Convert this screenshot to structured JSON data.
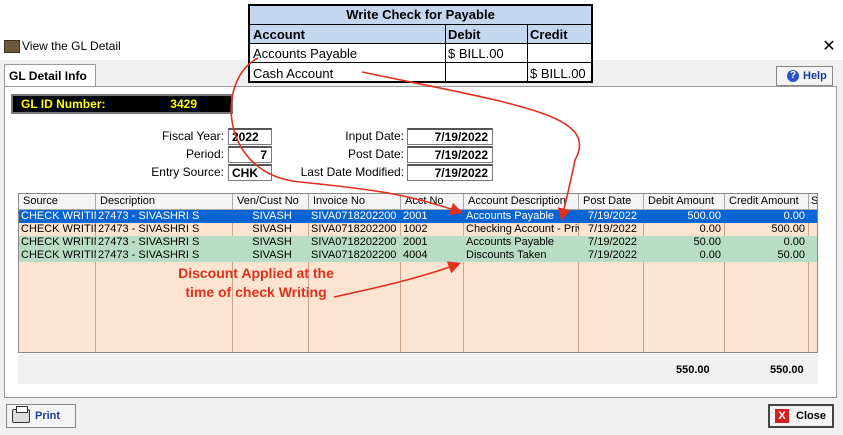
{
  "window": {
    "title": "View the GL Detail",
    "close_glyph": "✕"
  },
  "tabs": [
    {
      "label": "GL Detail Info"
    }
  ],
  "help_label": "Help",
  "gl_id": {
    "label": "GL ID Number:",
    "value": "3429"
  },
  "form": {
    "fiscal_year_label": "Fiscal Year:",
    "fiscal_year": "2022",
    "period_label": "Period:",
    "period": "7",
    "entry_source_label": "Entry Source:",
    "entry_source": "CHK",
    "input_date_label": "Input Date:",
    "input_date": "7/19/2022",
    "post_date_label": "Post Date:",
    "post_date": "7/19/2022",
    "last_modified_label": "Last Date Modified:",
    "last_modified": "7/19/2022"
  },
  "grid": {
    "columns": [
      "Source",
      "Description",
      "Ven/Cust No",
      "Invoice No",
      "Acct No",
      "Account Description",
      "Post Date",
      "Debit Amount",
      "Credit Amount",
      "Se"
    ],
    "rows": [
      {
        "source": "CHECK WRITIN",
        "description": "27473 - SIVASHRI S",
        "ven": "SIVASH",
        "invoice": "SIVA0718202200",
        "acct": "2001",
        "acct_desc": "Accounts Payable",
        "post_date": "7/19/2022",
        "debit": "500.00",
        "credit": "0.00",
        "style": "selected"
      },
      {
        "source": "CHECK WRITIN",
        "description": "27473 - SIVASHRI S",
        "ven": "SIVASH",
        "invoice": "SIVA0718202200",
        "acct": "1002",
        "acct_desc": "Checking Account - Priv",
        "post_date": "7/19/2022",
        "debit": "0.00",
        "credit": "500.00",
        "style": "normal"
      },
      {
        "source": "CHECK WRITIN",
        "description": "27473 - SIVASHRI S",
        "ven": "SIVASH",
        "invoice": "SIVA0718202200",
        "acct": "2001",
        "acct_desc": "Accounts Payable",
        "post_date": "7/19/2022",
        "debit": "50.00",
        "credit": "0.00",
        "style": "highlight"
      },
      {
        "source": "CHECK WRITIN",
        "description": "27473 - SIVASHRI S",
        "ven": "SIVASH",
        "invoice": "SIVA0718202200",
        "acct": "4004",
        "acct_desc": "Discounts Taken",
        "post_date": "7/19/2022",
        "debit": "0.00",
        "credit": "50.00",
        "style": "highlight"
      }
    ],
    "total_debit": "550.00",
    "total_credit": "550.00"
  },
  "buttons": {
    "print": "Print",
    "close": "Close",
    "close_glyph": "X",
    "help_glyph": "?"
  },
  "overlay": {
    "title": "Write Check for Payable",
    "headers": [
      "Account",
      "Debit",
      "Credit"
    ],
    "rows": [
      {
        "account": "Accounts Payable",
        "debit": "$ BILL.00",
        "credit": ""
      },
      {
        "account": "Cash Account",
        "debit": "",
        "credit": "$ BILL.00"
      }
    ]
  },
  "annotation": {
    "line1": "Discount Applied at the",
    "line2": "time of check Writing"
  },
  "colors": {
    "selected_row": "#0a64d4",
    "highlight_row": "#b7ddc4",
    "grid_bg": "#fde4d0",
    "annotation": "#e0301e",
    "arrow": "#e0301e"
  }
}
